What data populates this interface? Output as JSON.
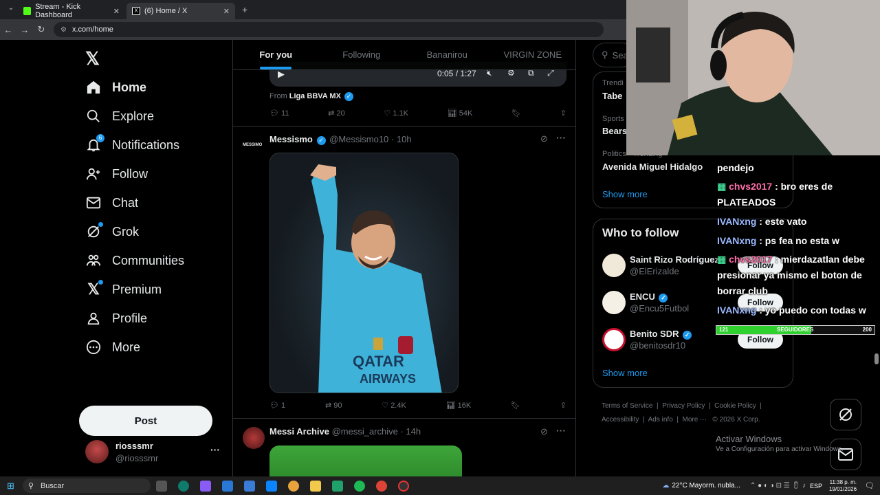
{
  "browser": {
    "tabs": [
      {
        "title": "Stream - Kick Dashboard",
        "color": "#53fc18"
      },
      {
        "title": "(6) Home / X",
        "color": "#ffffff"
      }
    ],
    "url": "x.com/home"
  },
  "left_nav": {
    "items": [
      {
        "label": "Home",
        "icon": "home-icon"
      },
      {
        "label": "Explore",
        "icon": "search-icon"
      },
      {
        "label": "Notifications",
        "icon": "bell-icon",
        "badge": "6"
      },
      {
        "label": "Follow",
        "icon": "add-person-icon"
      },
      {
        "label": "Chat",
        "icon": "mail-icon"
      },
      {
        "label": "Grok",
        "icon": "grok-icon"
      },
      {
        "label": "Communities",
        "icon": "people-icon"
      },
      {
        "label": "Premium",
        "icon": "x-logo-icon"
      },
      {
        "label": "Profile",
        "icon": "person-icon"
      },
      {
        "label": "More",
        "icon": "more-circle-icon"
      }
    ],
    "post_label": "Post",
    "profile": {
      "name": "riosssmr",
      "handle": "@riosssmr"
    }
  },
  "timeline": {
    "tabs": [
      "For you",
      "Following",
      "Bananirou",
      "VIRGIN ZONE"
    ],
    "video_time": "0:05 / 1:27",
    "from_label": "From",
    "from_source": "Liga BBVA MX",
    "post1_stats": {
      "replies": "11",
      "reposts": "20",
      "likes": "1.1K",
      "views": "54K"
    },
    "post2": {
      "name": "Messismo",
      "handle": "@Messismo10",
      "time": "· 10h",
      "avatar_text": "MESSIMO",
      "stats": {
        "replies": "1",
        "reposts": "90",
        "likes": "2.4K",
        "views": "16K"
      }
    },
    "post3": {
      "name": "Messi Archive",
      "handle": "@messi_archive",
      "time": "· 14h"
    }
  },
  "right_sidebar": {
    "search_placeholder": "Sea",
    "trends": [
      {
        "context": "Trendi",
        "title": "Tabe"
      },
      {
        "context": "Sports",
        "title": "Bears"
      },
      {
        "context": "Politics · Trending",
        "title": "Avenida Miguel Hidalgo"
      }
    ],
    "show_more": "Show more",
    "who_to_follow_title": "Who to follow",
    "accounts": [
      {
        "name": "Saint Rizo Rodríguez",
        "handle": "@ElErizalde"
      },
      {
        "name": "ENCU",
        "handle": "@Encu5Futbol"
      },
      {
        "name": "Benito SDR",
        "handle": "@benitosdr10"
      }
    ],
    "follow_label": "Follow",
    "show_more2": "Show more",
    "footer": [
      "Terms of Service",
      "Privacy Policy",
      "Cookie Policy",
      "Accessibility",
      "Ads info",
      "More ···",
      "© 2026 X Corp."
    ]
  },
  "overlay": {
    "chat": [
      {
        "user": "",
        "text": "pendejo"
      },
      {
        "user": "chvs2017",
        "text": ": bro eres de PLATEADOS",
        "color": "pink"
      },
      {
        "user": "IVANxng",
        "text": ": este vato",
        "color": "blue"
      },
      {
        "user": "IVANxng",
        "text": ": ps fea no esta w",
        "color": "blue"
      },
      {
        "user": "chvs2017",
        "text": ": mierdazatlan debe presionar ya mismo el boton de borrar club",
        "color": "pink"
      },
      {
        "user": "IVANxng",
        "text": ": yo puedo con todas w",
        "color": "blue"
      }
    ],
    "follower_goal": {
      "current": "121",
      "label": "SEGUIDORES",
      "goal": "200",
      "fraction": 0.6
    }
  },
  "windows": {
    "activate_title": "Activar Windows",
    "activate_sub": "Ve a Configuración para activar Windows.",
    "search_label": "Buscar",
    "weather": "22°C  Mayorm. nubla...",
    "lang": "ESP",
    "time": "11:38 p. m.",
    "date": "19/01/2026"
  }
}
